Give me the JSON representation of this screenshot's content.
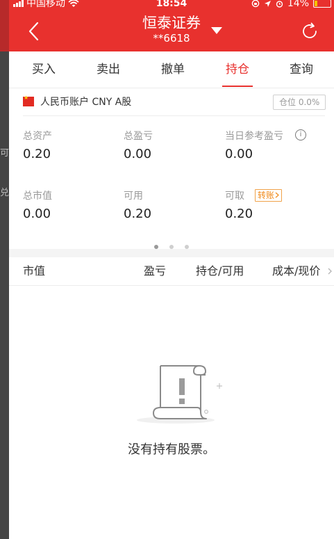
{
  "status_bar": {
    "carrier": "中国移动",
    "time": "18:54",
    "battery": "14%"
  },
  "nav": {
    "title": "恒泰证券",
    "subtitle": "**6618"
  },
  "tabs": [
    {
      "label": "买入"
    },
    {
      "label": "卖出"
    },
    {
      "label": "撤单"
    },
    {
      "label": "持仓",
      "active": true
    },
    {
      "label": "查询"
    }
  ],
  "account": {
    "label": "人民币账户 CNY A股",
    "position_ratio": "仓位 0.0%"
  },
  "stats": {
    "total_assets_label": "总资产",
    "total_assets_value": "0.20",
    "total_pnl_label": "总盈亏",
    "total_pnl_value": "0.00",
    "today_pnl_label": "当日参考盈亏",
    "today_pnl_value": "0.00",
    "market_value_label": "总市值",
    "market_value_value": "0.00",
    "available_label": "可用",
    "available_value": "0.20",
    "withdrawable_label": "可取",
    "withdrawable_value": "0.20",
    "transfer_label": "转账",
    "info_glyph": "i"
  },
  "table_header": {
    "market_value": "市值",
    "pnl": "盈亏",
    "position_available": "持仓/可用",
    "cost_price": "成本/现价"
  },
  "empty_state": {
    "message": "没有持有股票。"
  },
  "edge_strip_chars": [
    "可",
    "兑"
  ],
  "colors": {
    "brand_red": "#e8312e",
    "accent_orange": "#f08a1a"
  },
  "icons": {
    "back": "chevron-left-icon",
    "dropdown": "caret-down-icon",
    "refresh": "refresh-icon",
    "info": "info-icon",
    "flag": "china-flag-icon",
    "column_more": "chevron-right-icon",
    "empty": "document-exclamation-icon"
  }
}
